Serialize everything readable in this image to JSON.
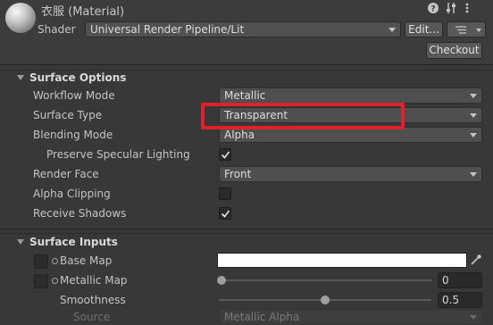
{
  "header": {
    "title": "衣服 (Material)",
    "shader_label": "Shader",
    "shader_value": "Universal Render Pipeline/Lit",
    "edit_button": "Edit...",
    "checkout_button": "Checkout",
    "icons": [
      "help-icon",
      "settings-sliders-icon",
      "more-options-icon",
      "list-icon"
    ]
  },
  "surface_options": {
    "title": "Surface Options",
    "rows": {
      "workflow_mode": {
        "label": "Workflow Mode",
        "value": "Metallic"
      },
      "surface_type": {
        "label": "Surface Type",
        "value": "Transparent"
      },
      "blending_mode": {
        "label": "Blending Mode",
        "value": "Alpha"
      },
      "preserve_specular": {
        "label": "Preserve Specular Lighting",
        "checked": true
      },
      "render_face": {
        "label": "Render Face",
        "value": "Front"
      },
      "alpha_clipping": {
        "label": "Alpha Clipping",
        "checked": false
      },
      "receive_shadows": {
        "label": "Receive Shadows",
        "checked": true
      }
    }
  },
  "surface_inputs": {
    "title": "Surface Inputs",
    "base_map": {
      "label": "Base Map",
      "color": "#ffffff"
    },
    "metallic_map": {
      "label": "Metallic Map",
      "value": "0",
      "slider_fraction": 0.0
    },
    "smoothness": {
      "label": "Smoothness",
      "value": "0.5",
      "slider_fraction": 0.5
    },
    "source": {
      "label": "Source",
      "value": "Metallic Alpha"
    }
  },
  "colors": {
    "highlight": "#e0202a",
    "panel_bg": "#383838"
  }
}
